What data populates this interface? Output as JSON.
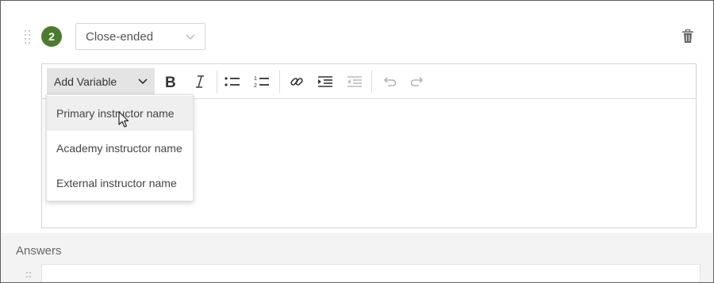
{
  "question": {
    "number": "2",
    "type_selected": "Close-ended"
  },
  "toolbar": {
    "add_variable_label": "Add Variable",
    "buttons": [
      "bold",
      "italic",
      "bulleted-list",
      "numbered-list",
      "link",
      "indent",
      "outdent",
      "undo",
      "redo"
    ]
  },
  "variable_menu": {
    "items": [
      "Primary instructor name",
      "Academy instructor name",
      "External instructor name"
    ],
    "hovered_index": 0
  },
  "answers": {
    "label": "Answers"
  },
  "colors": {
    "badge": "#4d7a2c",
    "toolbar_dropdown_bg": "#e4e4e4",
    "answers_bg": "#f3f3f3",
    "icon": "#333333"
  },
  "icons": [
    "drag-handle-icon",
    "chevron-down-icon",
    "trash-icon",
    "bold-icon",
    "italic-icon",
    "bulleted-list-icon",
    "numbered-list-icon",
    "link-icon",
    "indent-icon",
    "outdent-icon",
    "undo-icon",
    "redo-icon",
    "pointer-cursor-icon"
  ]
}
